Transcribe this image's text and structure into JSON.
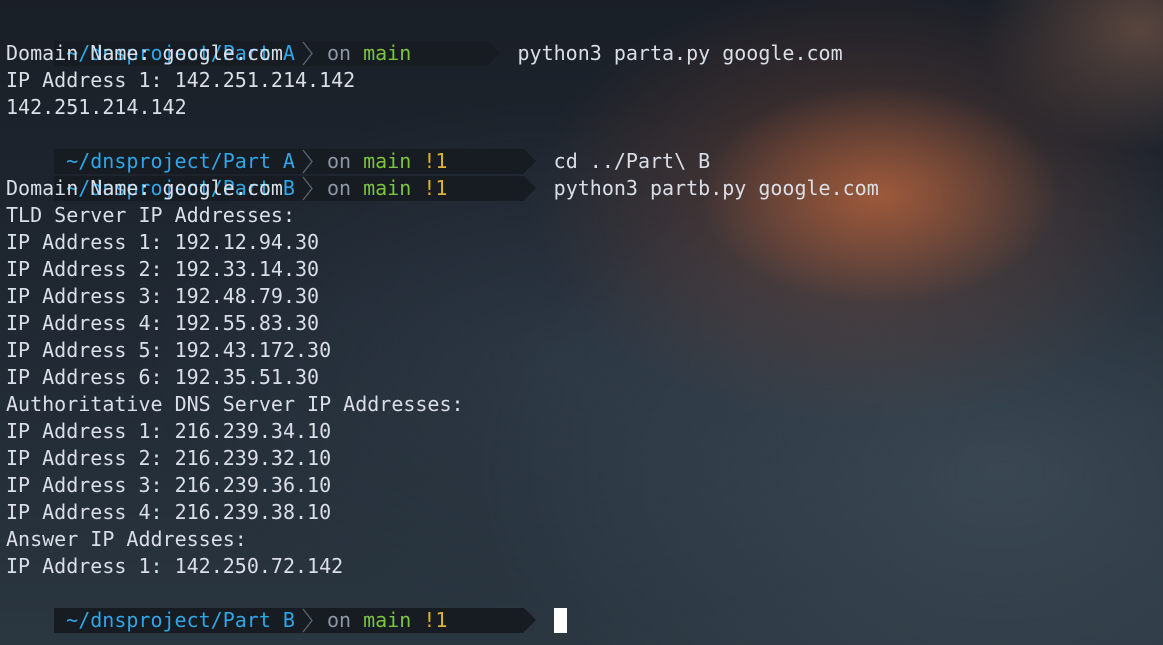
{
  "terminal": {
    "colors": {
      "directory": "#2fa6e6",
      "branch": "#7cc43c",
      "git_status": "#e0b32c",
      "muted": "#8e96a3",
      "prompt_background": "#171b22"
    },
    "separator_icon": "chevron-right-icon",
    "prompts": [
      {
        "dir": "~/dnsproject/Part A",
        "on": "on",
        "branch": "main",
        "status": "",
        "command": "python3 parta.py google.com"
      },
      {
        "dir": "~/dnsproject/Part A",
        "on": "on",
        "branch": "main",
        "status": "!1",
        "command": "cd ../Part\\ B"
      },
      {
        "dir": "~/dnsproject/Part B",
        "on": "on",
        "branch": "main",
        "status": "!1",
        "command": "python3 partb.py google.com"
      },
      {
        "dir": "~/dnsproject/Part B",
        "on": "on",
        "branch": "main",
        "status": "!1",
        "command": ""
      }
    ],
    "output_a": [
      "Domain Name: google.com",
      "IP Address 1: 142.251.214.142",
      "142.251.214.142"
    ],
    "output_b": [
      "Domain Name: google.com",
      "TLD Server IP Addresses:",
      "IP Address 1: 192.12.94.30",
      "IP Address 2: 192.33.14.30",
      "IP Address 3: 192.48.79.30",
      "IP Address 4: 192.55.83.30",
      "IP Address 5: 192.43.172.30",
      "IP Address 6: 192.35.51.30",
      "Authoritative DNS Server IP Addresses:",
      "IP Address 1: 216.239.34.10",
      "IP Address 2: 216.239.32.10",
      "IP Address 3: 216.239.36.10",
      "IP Address 4: 216.239.38.10",
      "Answer IP Addresses:",
      "IP Address 1: 142.250.72.142"
    ]
  }
}
